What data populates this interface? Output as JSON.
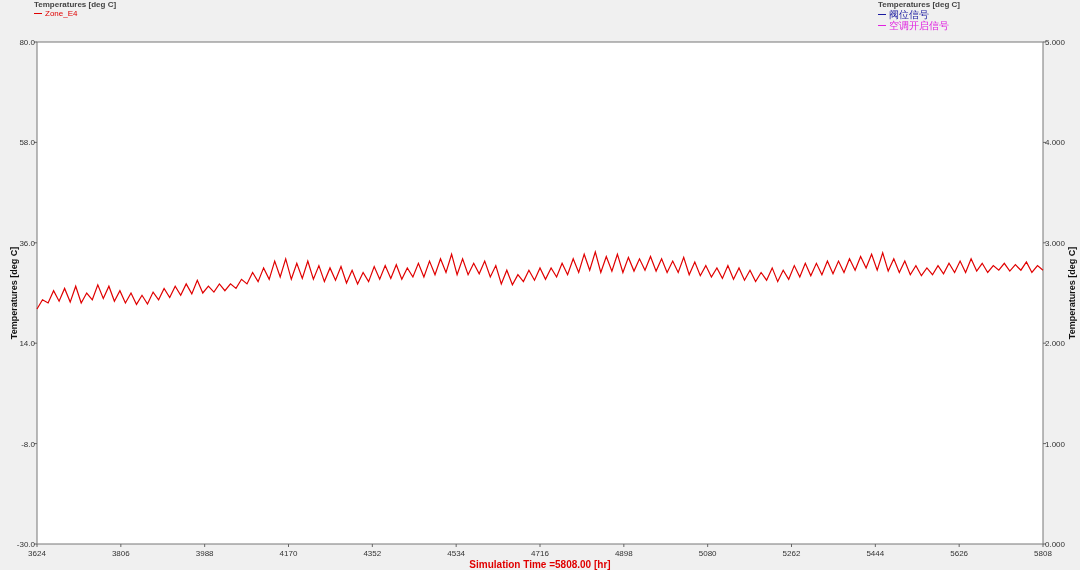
{
  "legend_left": {
    "title": "Temperatures [deg C]"
  },
  "legend_right": {
    "title": "Temperatures [deg C]",
    "items": [
      {
        "label": "阀位信号",
        "color": "#1a1aa0"
      },
      {
        "label": "空调开启信号",
        "color": "#e020e0"
      }
    ]
  },
  "right_axis": {
    "label": "Temperatures  [deg C]",
    "ticks": [
      "5.000",
      "4.000",
      "3.000",
      "2.000",
      "1.000",
      "0.000"
    ]
  },
  "chart_data": {
    "type": "line",
    "xlabel": "Simulation Time =5808.00 [hr]",
    "ylabel": "Temperatures  [deg C]",
    "xlim": [
      3624,
      5808
    ],
    "ylim": [
      -30,
      80
    ],
    "xticks": [
      3624,
      3806,
      3988,
      4170,
      4352,
      4534,
      4716,
      4898,
      5080,
      5262,
      5444,
      5626,
      5808
    ],
    "yticks": [
      {
        "value": -30,
        "label": "-30.0"
      },
      {
        "value": -8,
        "label": "-8.0"
      },
      {
        "value": 14,
        "label": "14.0"
      },
      {
        "value": 36,
        "label": "36.0"
      },
      {
        "value": 58,
        "label": "58.0"
      },
      {
        "value": 80,
        "label": "80.0"
      }
    ],
    "x": [
      3624,
      3636,
      3648,
      3660,
      3672,
      3684,
      3696,
      3708,
      3720,
      3732,
      3744,
      3756,
      3768,
      3780,
      3792,
      3804,
      3816,
      3828,
      3840,
      3852,
      3864,
      3876,
      3888,
      3900,
      3912,
      3924,
      3936,
      3948,
      3960,
      3972,
      3984,
      3996,
      4008,
      4020,
      4032,
      4044,
      4056,
      4068,
      4080,
      4092,
      4104,
      4116,
      4128,
      4140,
      4152,
      4164,
      4176,
      4188,
      4200,
      4212,
      4224,
      4236,
      4248,
      4260,
      4272,
      4284,
      4296,
      4308,
      4320,
      4332,
      4344,
      4356,
      4368,
      4380,
      4392,
      4404,
      4416,
      4428,
      4440,
      4452,
      4464,
      4476,
      4488,
      4500,
      4512,
      4524,
      4536,
      4548,
      4560,
      4572,
      4584,
      4596,
      4608,
      4620,
      4632,
      4644,
      4656,
      4668,
      4680,
      4692,
      4704,
      4716,
      4728,
      4740,
      4752,
      4764,
      4776,
      4788,
      4800,
      4812,
      4824,
      4836,
      4848,
      4860,
      4872,
      4884,
      4896,
      4908,
      4920,
      4932,
      4944,
      4956,
      4968,
      4980,
      4992,
      5004,
      5016,
      5028,
      5040,
      5052,
      5064,
      5076,
      5088,
      5100,
      5112,
      5124,
      5136,
      5148,
      5160,
      5172,
      5184,
      5196,
      5208,
      5220,
      5232,
      5244,
      5256,
      5268,
      5280,
      5292,
      5304,
      5316,
      5328,
      5340,
      5352,
      5364,
      5376,
      5388,
      5400,
      5412,
      5424,
      5436,
      5448,
      5460,
      5472,
      5484,
      5496,
      5508,
      5520,
      5532,
      5544,
      5556,
      5568,
      5580,
      5592,
      5604,
      5616,
      5628,
      5640,
      5652,
      5664,
      5676,
      5688,
      5700,
      5712,
      5724,
      5736,
      5748,
      5760,
      5772,
      5784,
      5796,
      5808
    ],
    "series": [
      {
        "name": "Zone_E4",
        "color": "#e00000",
        "values": [
          21.5,
          23.5,
          22.8,
          25.5,
          23.2,
          26.0,
          23.0,
          26.5,
          22.8,
          25.0,
          23.5,
          26.8,
          23.8,
          26.5,
          23.2,
          25.5,
          22.8,
          25.0,
          22.5,
          24.5,
          22.6,
          25.2,
          23.5,
          26.0,
          24.0,
          26.5,
          24.5,
          27.0,
          24.8,
          27.8,
          25.0,
          26.5,
          25.2,
          27.0,
          25.5,
          27.0,
          26.0,
          28.0,
          27.0,
          29.5,
          27.5,
          30.5,
          28.0,
          32.0,
          28.5,
          32.5,
          28.0,
          31.5,
          28.2,
          32.0,
          28.0,
          31.0,
          27.5,
          30.5,
          27.8,
          30.8,
          27.2,
          30.0,
          27.0,
          29.5,
          27.5,
          30.8,
          28.0,
          31.0,
          28.2,
          31.2,
          28.0,
          30.5,
          28.5,
          31.5,
          28.5,
          32.0,
          29.0,
          32.5,
          29.5,
          33.5,
          29.0,
          32.5,
          29.0,
          31.5,
          29.2,
          32.0,
          28.5,
          31.0,
          27.0,
          30.0,
          26.8,
          29.0,
          27.5,
          30.0,
          27.8,
          30.5,
          28.0,
          30.5,
          28.5,
          31.5,
          29.0,
          32.5,
          29.5,
          33.5,
          30.0,
          34.0,
          29.5,
          33.0,
          29.8,
          33.5,
          29.5,
          32.8,
          29.8,
          32.5,
          30.0,
          33.0,
          29.8,
          32.5,
          29.5,
          32.0,
          29.5,
          32.8,
          29.0,
          31.8,
          28.8,
          31.0,
          28.5,
          30.5,
          28.2,
          31.0,
          28.0,
          30.5,
          27.8,
          30.0,
          27.5,
          29.5,
          27.8,
          30.5,
          27.5,
          30.0,
          28.0,
          31.0,
          28.5,
          31.5,
          28.8,
          31.5,
          29.0,
          32.0,
          29.2,
          32.0,
          29.5,
          32.5,
          30.0,
          33.0,
          30.5,
          33.5,
          30.0,
          33.8,
          29.8,
          32.5,
          29.5,
          32.0,
          29.0,
          31.0,
          28.8,
          30.5,
          29.0,
          31.0,
          29.2,
          31.5,
          29.5,
          32.0,
          29.5,
          32.5,
          29.8,
          31.5,
          29.5,
          31.0,
          30.0,
          31.5,
          29.8,
          31.2,
          30.0,
          31.8,
          29.5,
          31.0,
          30.0
        ]
      }
    ]
  }
}
